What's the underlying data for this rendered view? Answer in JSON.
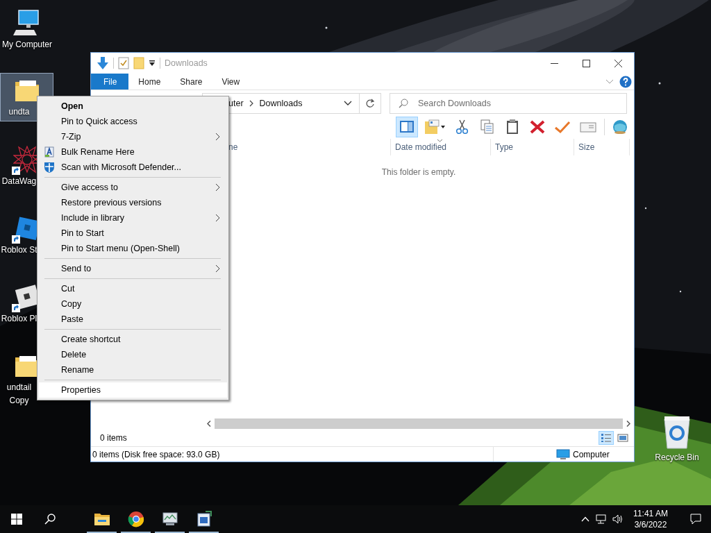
{
  "desktop": {
    "icons": [
      {
        "kind": "computer",
        "lines": [
          "My Computer"
        ],
        "selected": false,
        "shortcut": false
      },
      {
        "kind": "folder",
        "lines": [
          "undta"
        ],
        "selected": true,
        "shortcut": false
      },
      {
        "kind": "star-web",
        "lines": [
          "DataWag"
        ],
        "selected": false,
        "shortcut": true
      },
      {
        "kind": "blue-tile",
        "lines": [
          "Roblox St"
        ],
        "selected": false,
        "shortcut": true
      },
      {
        "kind": "white-tile",
        "lines": [
          "Roblox Pl"
        ],
        "selected": false,
        "shortcut": true
      },
      {
        "kind": "folder",
        "lines": [
          "undtail",
          "Copy"
        ],
        "selected": false,
        "shortcut": false
      }
    ],
    "recycle_bin": {
      "label": "Recycle Bin"
    }
  },
  "explorer": {
    "title": "Downloads",
    "ribbon_tabs": [
      {
        "label": "File",
        "selected": true
      },
      {
        "label": "Home",
        "selected": false
      },
      {
        "label": "Share",
        "selected": false
      },
      {
        "label": "View",
        "selected": false
      }
    ],
    "address": {
      "crumbs": [
        "uter",
        "Downloads"
      ]
    },
    "search": {
      "placeholder": "Search Downloads"
    },
    "toolbar": [
      {
        "kind": "preview-pane",
        "selected": true
      },
      {
        "kind": "properties",
        "selected": false
      },
      {
        "kind": "cut",
        "selected": false
      },
      {
        "kind": "copy",
        "selected": false
      },
      {
        "kind": "paste",
        "selected": false
      },
      {
        "kind": "delete",
        "selected": false
      },
      {
        "kind": "check",
        "selected": false
      },
      {
        "kind": "email",
        "selected": false
      },
      {
        "kind": "globe",
        "selected": false
      }
    ],
    "columns": [
      "ne",
      "Date modified",
      "Type",
      "Size"
    ],
    "empty_message": "This folder is empty.",
    "item_count": "0 items",
    "views": [
      {
        "kind": "details",
        "selected": true
      },
      {
        "kind": "large-icons",
        "selected": false
      }
    ],
    "status": {
      "text": "0 items (Disk free space: 93.0 GB)",
      "location": "Computer"
    }
  },
  "context_menu": {
    "items": [
      {
        "kind": "item",
        "label": "Open",
        "default": true,
        "submenu": false,
        "highlighted": false
      },
      {
        "kind": "item",
        "label": "Pin to Quick access",
        "default": false,
        "submenu": false,
        "highlighted": false
      },
      {
        "kind": "item",
        "label": "7-Zip",
        "default": false,
        "submenu": true,
        "highlighted": false
      },
      {
        "kind": "rename-tool",
        "label": "Bulk Rename Here",
        "default": false,
        "submenu": false,
        "highlighted": false
      },
      {
        "kind": "scan-tool",
        "label": "Scan with Microsoft Defender...",
        "default": false,
        "submenu": false,
        "highlighted": false
      },
      {
        "kind": "separator"
      },
      {
        "kind": "item",
        "label": "Give access to",
        "default": false,
        "submenu": true,
        "highlighted": false
      },
      {
        "kind": "item",
        "label": "Restore previous versions",
        "default": false,
        "submenu": false,
        "highlighted": false
      },
      {
        "kind": "item",
        "label": "Include in library",
        "default": false,
        "submenu": true,
        "highlighted": false
      },
      {
        "kind": "item",
        "label": "Pin to Start",
        "default": false,
        "submenu": false,
        "highlighted": false
      },
      {
        "kind": "item",
        "label": "Pin to Start menu (Open-Shell)",
        "default": false,
        "submenu": false,
        "highlighted": false
      },
      {
        "kind": "separator"
      },
      {
        "kind": "item",
        "label": "Send to",
        "default": false,
        "submenu": true,
        "highlighted": false
      },
      {
        "kind": "separator"
      },
      {
        "kind": "item",
        "label": "Cut",
        "default": false,
        "submenu": false,
        "highlighted": false
      },
      {
        "kind": "item",
        "label": "Copy",
        "default": false,
        "submenu": false,
        "highlighted": false
      },
      {
        "kind": "item",
        "label": "Paste",
        "default": false,
        "submenu": false,
        "highlighted": false
      },
      {
        "kind": "separator"
      },
      {
        "kind": "item",
        "label": "Create shortcut",
        "default": false,
        "submenu": false,
        "highlighted": false
      },
      {
        "kind": "item",
        "label": "Delete",
        "default": false,
        "submenu": false,
        "highlighted": false
      },
      {
        "kind": "item",
        "label": "Rename",
        "default": false,
        "submenu": false,
        "highlighted": false
      },
      {
        "kind": "separator"
      },
      {
        "kind": "item",
        "label": "Properties",
        "default": false,
        "submenu": false,
        "highlighted": true
      }
    ]
  },
  "taskbar": {
    "apps": [
      {
        "kind": "folder",
        "running": true
      },
      {
        "kind": "browser",
        "running": true
      },
      {
        "kind": "monitor",
        "running": true
      },
      {
        "kind": "text-tool",
        "running": true
      }
    ],
    "clock": {
      "time": "11:41 AM",
      "date": "3/6/2022"
    }
  }
}
